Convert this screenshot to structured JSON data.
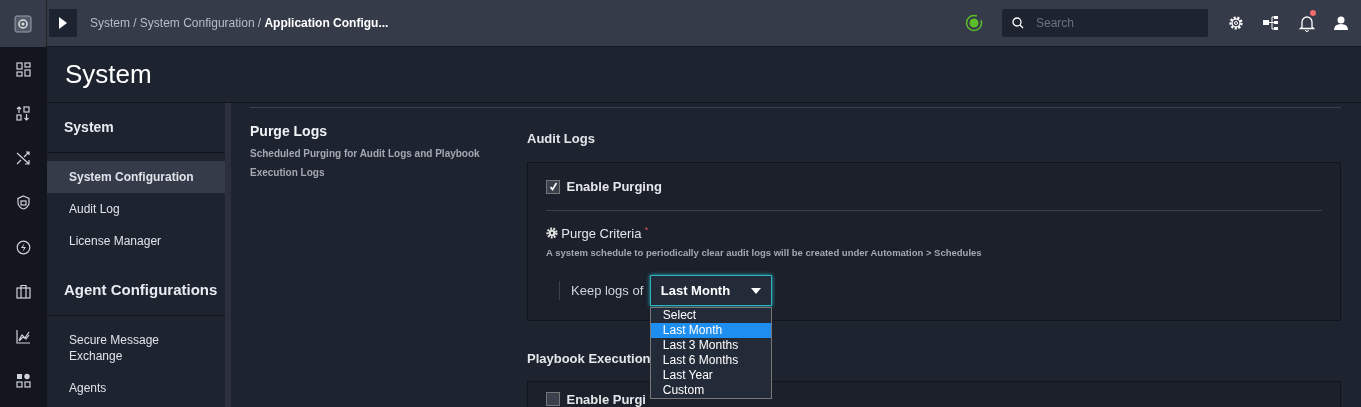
{
  "breadcrumb": {
    "separator": "/",
    "items": [
      {
        "label": "System",
        "current": false
      },
      {
        "label": "System Configuration",
        "current": false
      },
      {
        "label": "Application Configu...",
        "current": true
      }
    ]
  },
  "search": {
    "placeholder": "Search"
  },
  "notifications": {
    "unread": true
  },
  "rail": {
    "items": [
      {
        "kind": "dashboard"
      },
      {
        "kind": "sort"
      },
      {
        "kind": "shuffle"
      },
      {
        "kind": "shield"
      },
      {
        "kind": "bolt"
      },
      {
        "kind": "briefcase"
      },
      {
        "kind": "chart"
      },
      {
        "kind": "apps"
      }
    ]
  },
  "page_title": "System",
  "sidebar": {
    "groups": [
      {
        "title": "System",
        "items": [
          {
            "label": "System Configuration",
            "selected": true
          },
          {
            "label": "Audit Log",
            "selected": false
          },
          {
            "label": "License Manager",
            "selected": false
          }
        ]
      },
      {
        "title": "Agent Configurations",
        "items": [
          {
            "label": "Secure Message Exchange",
            "selected": false
          },
          {
            "label": "Agents",
            "selected": false
          }
        ]
      }
    ]
  },
  "section": {
    "title": "Purge Logs",
    "description": "Scheduled Purging for Audit Logs and Playbook Execution Logs"
  },
  "audit_logs": {
    "title": "Audit Logs",
    "enable_purging": {
      "label": "Enable Purging",
      "checked": true
    },
    "criteria_label": "Purge Criteria",
    "required_mark": "*",
    "help": "A system schedule to periodically clear audit logs will be created under Automation > Schedules",
    "keep_label": "Keep logs of",
    "select": {
      "value": "Last Month",
      "options": [
        {
          "label": "Select",
          "selected": false
        },
        {
          "label": "Last Month",
          "selected": true
        },
        {
          "label": "Last 3 Months",
          "selected": false
        },
        {
          "label": "Last 6 Months",
          "selected": false
        },
        {
          "label": "Last Year",
          "selected": false
        },
        {
          "label": "Custom",
          "selected": false
        }
      ]
    }
  },
  "playbook_logs": {
    "title": "Playbook Execution",
    "enable_purging": {
      "label": "Enable Purgi",
      "checked": false
    }
  }
}
